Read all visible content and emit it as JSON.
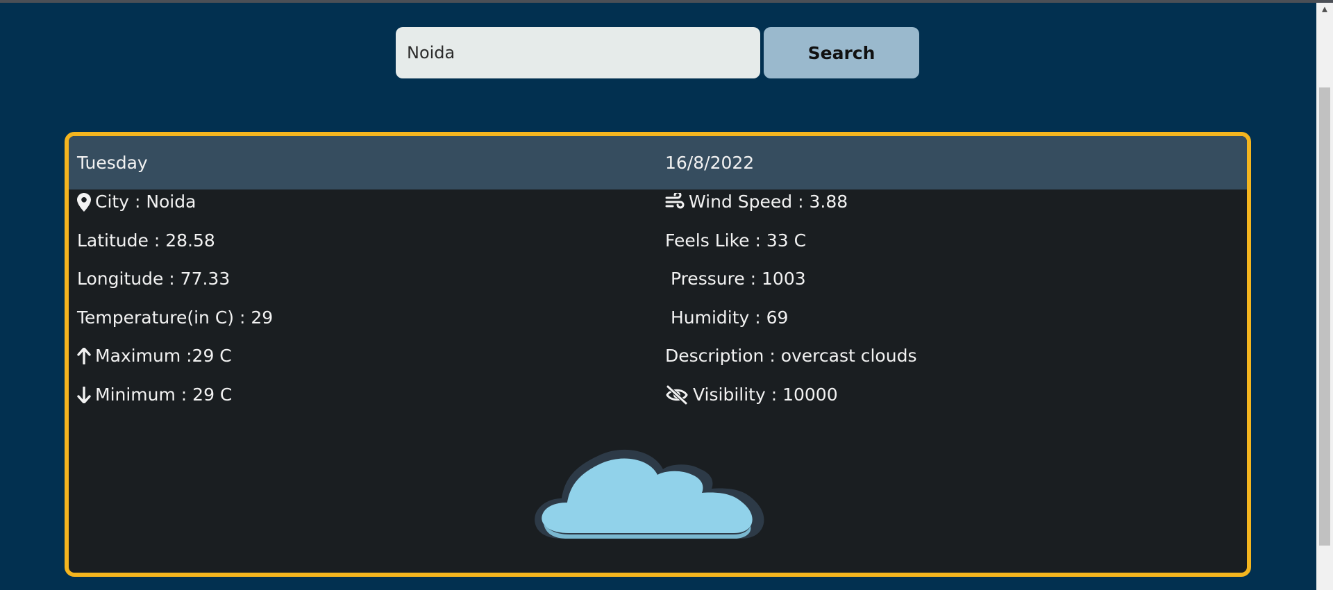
{
  "search": {
    "value": "Noida",
    "button_label": "Search"
  },
  "weather": {
    "day": "Tuesday",
    "date": "16/8/2022",
    "left": [
      {
        "icon": "map-pin-icon",
        "text": "City : Noida"
      },
      {
        "icon": "",
        "text": "Latitude : 28.58"
      },
      {
        "icon": "",
        "text": "Longitude : 77.33"
      },
      {
        "icon": "",
        "text": "Temperature(in C) : 29"
      },
      {
        "icon": "arrow-up-icon",
        "text": "Maximum :29 C"
      },
      {
        "icon": "arrow-down-icon",
        "text": "Minimum : 29 C"
      }
    ],
    "right": [
      {
        "icon": "wind-icon",
        "text": "Wind Speed : 3.88"
      },
      {
        "icon": "",
        "text": "Feels Like : 33 C"
      },
      {
        "icon": "",
        "text": " Pressure : 1003"
      },
      {
        "icon": "",
        "text": " Humidity : 69"
      },
      {
        "icon": "",
        "text": "Description : overcast clouds"
      },
      {
        "icon": "eye-slash-icon",
        "text": "Visibility : 10000"
      }
    ],
    "image_icon": "cloud-icon"
  },
  "colors": {
    "background": "#023050",
    "card_border": "#f4b51f",
    "card_header": "#364d5f",
    "card_body": "#1a1e21",
    "cloud": "#91d2ea"
  }
}
